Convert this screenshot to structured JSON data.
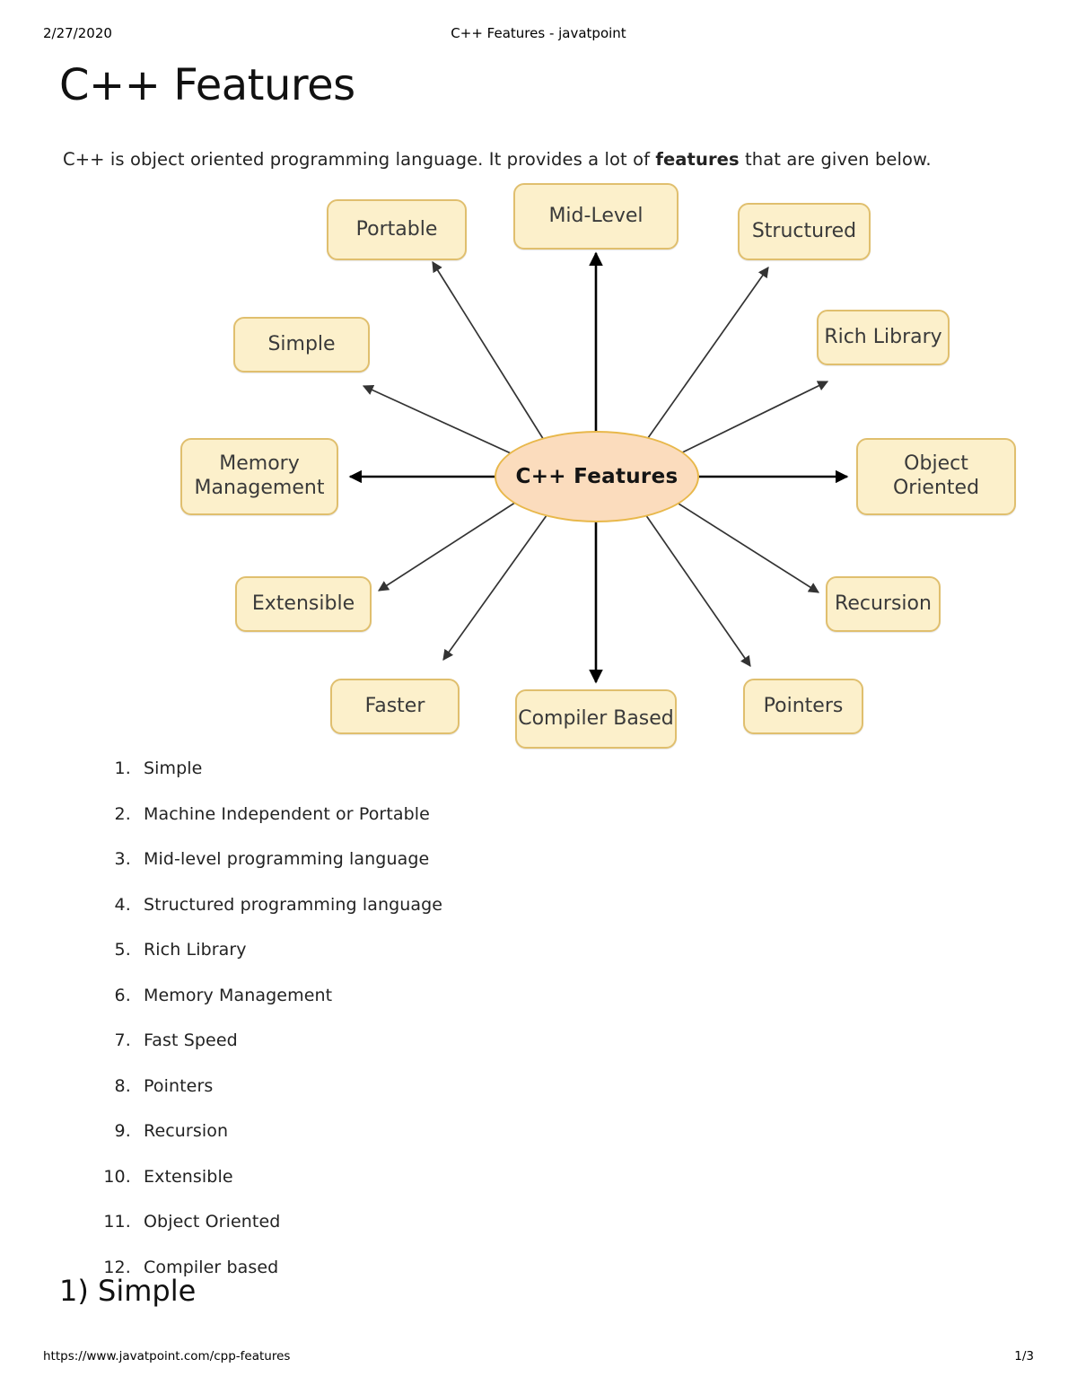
{
  "header": {
    "date": "2/27/2020",
    "title": "C++ Features - javatpoint"
  },
  "page": {
    "title": "C++ Features",
    "intro_before": "C++ is object oriented programming language. It provides a lot of ",
    "intro_bold": "features",
    "intro_after": " that are given below."
  },
  "diagram": {
    "center_label": "C++ Features",
    "colors": {
      "node_fill": "#fcf0cb",
      "node_border": "#e0bf6e",
      "center_fill": "#fbdcbd",
      "center_border": "#e8b84b",
      "arrow": "#333333"
    },
    "nodes": [
      {
        "id": "portable",
        "label": "Portable"
      },
      {
        "id": "mid-level",
        "label": "Mid-Level"
      },
      {
        "id": "structured",
        "label": "Structured"
      },
      {
        "id": "simple",
        "label": "Simple"
      },
      {
        "id": "rich-library",
        "label": "Rich Library"
      },
      {
        "id": "memory-management",
        "label": "Memory\nManagement",
        "line1": "Memory",
        "line2": "Management"
      },
      {
        "id": "object-oriented",
        "label": "Object\nOriented",
        "line1": "Object",
        "line2": "Oriented"
      },
      {
        "id": "extensible",
        "label": "Extensible"
      },
      {
        "id": "recursion",
        "label": "Recursion"
      },
      {
        "id": "faster",
        "label": "Faster"
      },
      {
        "id": "compiler-based",
        "label": "Compiler Based"
      },
      {
        "id": "pointers",
        "label": "Pointers"
      }
    ]
  },
  "feature_list": [
    "Simple",
    "Machine Independent or Portable",
    "Mid-level programming language",
    "Structured programming language",
    "Rich Library",
    "Memory Management",
    "Fast Speed",
    "Pointers",
    "Recursion",
    "Extensible",
    "Object Oriented",
    "Compiler based"
  ],
  "section_heading": "1) Simple",
  "footer": {
    "url": "https://www.javatpoint.com/cpp-features",
    "page_number": "1/3"
  }
}
